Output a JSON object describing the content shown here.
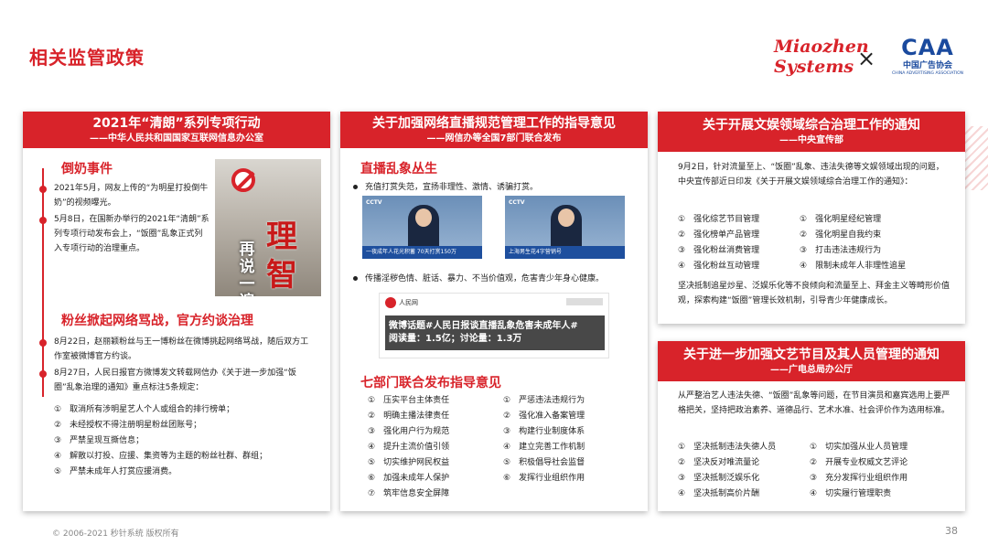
{
  "page_title": "相关监管政策",
  "logos": {
    "miaozhen": "Miaozhen Systems",
    "cross": "×",
    "caa_mark": "CAA",
    "caa_cn": "中国广告协会",
    "caa_en": "CHINA ADVERTISING ASSOCIATION"
  },
  "card1": {
    "title": "2021年“清朗”系列专项行动",
    "subtitle": "——中华人民共和国国家互联网信息办公室",
    "section1_title": "倒奶事件",
    "event1": "2021年5月，网友上传的“为明星打投倒牛奶”的视频曝光。",
    "event2": "5月8日，在国新办举行的2021年“清朗”系列专项行动发布会上，“饭圈”乱象正式列入专项行动的治理重点。",
    "image_text_a": "再说一遍",
    "image_text_b": "理智",
    "section2_title": "粉丝掀起网络骂战，官方约谈治理",
    "event3": "8月22日，赵丽颖粉丝与王一博粉丝在微博挑起网络骂战，随后双方工作室被微博官方约谈。",
    "event4": "8月27日，人民日报官方微博发文转载网信办《关于进一步加强“饭圈”乱象治理的通知》重点标注5条规定：",
    "rules": [
      "①　取消所有涉明星艺人个人或组合的排行榜单；",
      "②　未经授权不得注册明星粉丝团账号；",
      "③　严禁呈现互撕信息；",
      "④　解散以打投、应援、集资等为主题的粉丝社群、群组；",
      "⑤　严禁未成年人打赏应援消费。"
    ]
  },
  "card2": {
    "title": "关于加强网络直播规范管理工作的指导意见",
    "subtitle": "——网信办等全国7部门联合发布",
    "section1_title": "直播乱象丛生",
    "bullet1": "充值打赏失范，宣扬非理性、激情、诱骗打赏。",
    "video_left_caption": "一夜成年人花光积蓄 70天打赏150万",
    "video_right_caption": "上海男生花4字营销号",
    "video_logo": "CCTV",
    "bullet2": "传播淫秽色情、脏话、暴力、不当价值观，危害青少年身心健康。",
    "weibo_name": "人民网",
    "weibo_overlay_line1": "微博话题#人民日报谈直播乱象危害未成年人#",
    "weibo_overlay_line2": "阅读量：1.5亿；讨论量：1.3万",
    "section2_title": "七部门联合发布指导意见",
    "left_items": [
      "①　压实平台主体责任",
      "②　明确主播法律责任",
      "③　强化用户行为规范",
      "④　提升主流价值引领",
      "⑤　切实维护网民权益",
      "⑥　加强未成年人保护",
      "⑦　筑牢信息安全屏障"
    ],
    "right_items": [
      "①　严惩违法违规行为",
      "②　强化准入备案管理",
      "③　构建行业制度体系",
      "④　建立完善工作机制",
      "⑤　积极倡导社会监督",
      "⑥　发挥行业组织作用"
    ]
  },
  "card3": {
    "title": "关于开展文娱领域综合治理工作的通知",
    "subtitle": "——中央宣传部",
    "para1": "9月2日，针对流量至上、“饭圈”乱象、违法失德等文娱领域出现的问题，中央宣传部近日印发《关于开展文娱领域综合治理工作的通知》：",
    "left_items": [
      "①　强化综艺节目管理",
      "②　强化榜单产品管理",
      "③　强化粉丝消费管理",
      "④　强化粉丝互动管理"
    ],
    "right_items": [
      "①　强化明星经纪管理",
      "②　强化明星自我约束",
      "③　打击违法违规行为",
      "④　限制未成年人非理性追星"
    ],
    "para2": "坚决抵制追星炒星、泛娱乐化等不良倾向和流量至上、拜金主义等畸形价值观，探索构建“饭圈”管理长效机制，引导青少年健康成长。"
  },
  "card4": {
    "title": "关于进一步加强文艺节目及其人员管理的通知",
    "subtitle": "——广电总局办公厅",
    "para1": "从严整治艺人违法失德、“饭圈”乱象等问题，在节目演员和嘉宾选用上要严格把关，坚持把政治素养、道德品行、艺术水准、社会评价作为选用标准。",
    "left_items": [
      "①　坚决抵制违法失德人员",
      "②　坚决反对唯流量论",
      "③　坚决抵制泛娱乐化",
      "④　坚决抵制高价片酬"
    ],
    "right_items": [
      "①　切实加强从业人员管理",
      "②　开展专业权威文艺评论",
      "③　充分发挥行业组织作用",
      "④　切实履行管理职责"
    ]
  },
  "footer": "© 2006-2021 秒针系统 版权所有",
  "page_number": "38",
  "colors": {
    "accent": "#d8232a",
    "brand_blue": "#1a4a9e"
  }
}
